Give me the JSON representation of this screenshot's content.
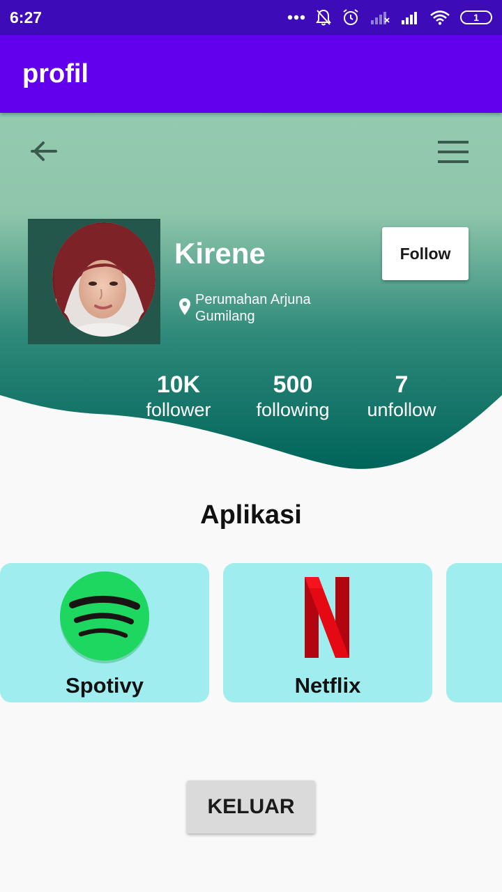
{
  "status_bar": {
    "time": "6:27",
    "battery": "1",
    "icons": [
      "more-icon",
      "bell-off-icon",
      "alarm-icon",
      "signal-off-icon",
      "signal-icon",
      "wifi-icon",
      "battery-icon"
    ]
  },
  "app_bar": {
    "title": "profil"
  },
  "header": {
    "gradient_top": "#94cbb0",
    "gradient_bottom": "#00645a",
    "back_icon": "arrow-back-icon",
    "menu_icon": "menu-icon"
  },
  "profile": {
    "name": "Kirene",
    "location": "Perumahan Arjuna Gumilang",
    "follow_label": "Follow"
  },
  "stats": [
    {
      "value": "10K",
      "label": "follower"
    },
    {
      "value": "500",
      "label": "following"
    },
    {
      "value": "7",
      "label": "unfollow"
    }
  ],
  "apps_section": {
    "title": "Aplikasi",
    "items": [
      {
        "label": "Spotivy",
        "icon": "spotify-icon",
        "color": "#1ed760"
      },
      {
        "label": "Netflix",
        "icon": "netflix-icon",
        "color": "#e50914"
      },
      {
        "label": "",
        "icon": "",
        "color": "#a0edef"
      }
    ]
  },
  "logout_label": "KELUAR",
  "colors": {
    "status_bar": "#3d0bb8",
    "app_bar": "#6200ee",
    "card": "#a0edef"
  }
}
